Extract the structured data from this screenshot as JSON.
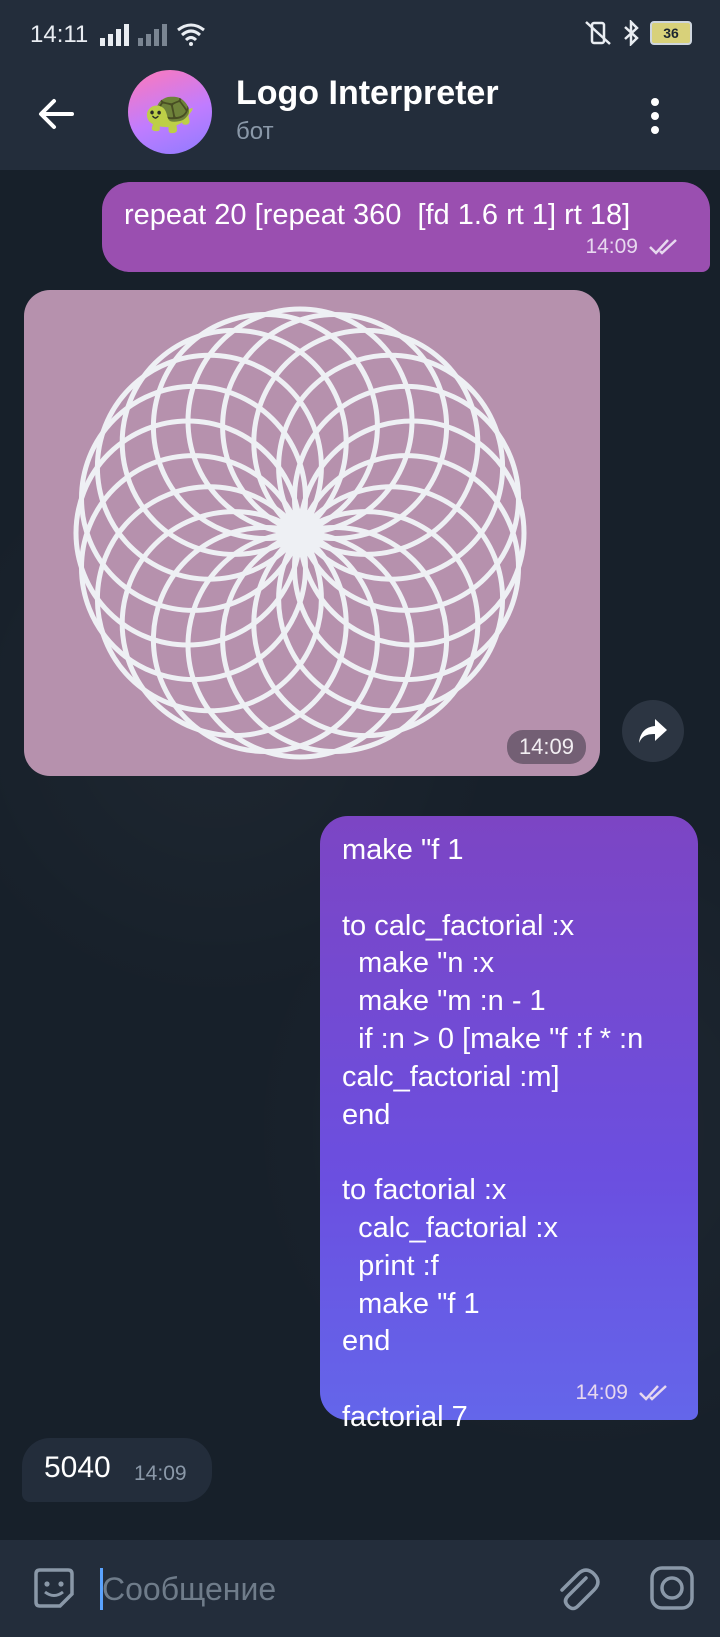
{
  "status_bar": {
    "time": "14:11",
    "battery": "36"
  },
  "header": {
    "title": "Logo Interpreter",
    "subtitle": "бот",
    "avatar_emoji": "🐢"
  },
  "messages": {
    "m1": {
      "text": "repeat 20 [repeat 360  [fd 1.6 rt 1] rt 18]",
      "time": "14:09"
    },
    "photo": {
      "time": "14:09"
    },
    "m2": {
      "text": "make \"f 1\n\nto calc_factorial :x\n  make \"n :x\n  make \"m :n - 1\n  if :n > 0 [make \"f :f * :n\ncalc_factorial :m]\nend\n\nto factorial :x\n  calc_factorial :x\n  print :f\n  make \"f 1\nend\n\nfactorial 7",
      "time": "14:09"
    },
    "m3": {
      "text": "5040",
      "time": "14:09"
    }
  },
  "input": {
    "placeholder": "Сообщение"
  },
  "colors": {
    "outgoing_bubble": "#9a4fb0",
    "outgoing_gradient_top": "#7c45c4",
    "outgoing_gradient_bottom": "#6466ea",
    "incoming_bubble": "#232d3b",
    "photo_background": "#b691ad",
    "accent": "#5aa3ff"
  },
  "icons": {
    "back": "arrow-left-icon",
    "menu": "more-vertical-icon",
    "share": "share-icon",
    "read_status": "double-check-icon",
    "emoji": "sticker-icon",
    "attach": "paperclip-icon",
    "camera": "camera-icon"
  }
}
